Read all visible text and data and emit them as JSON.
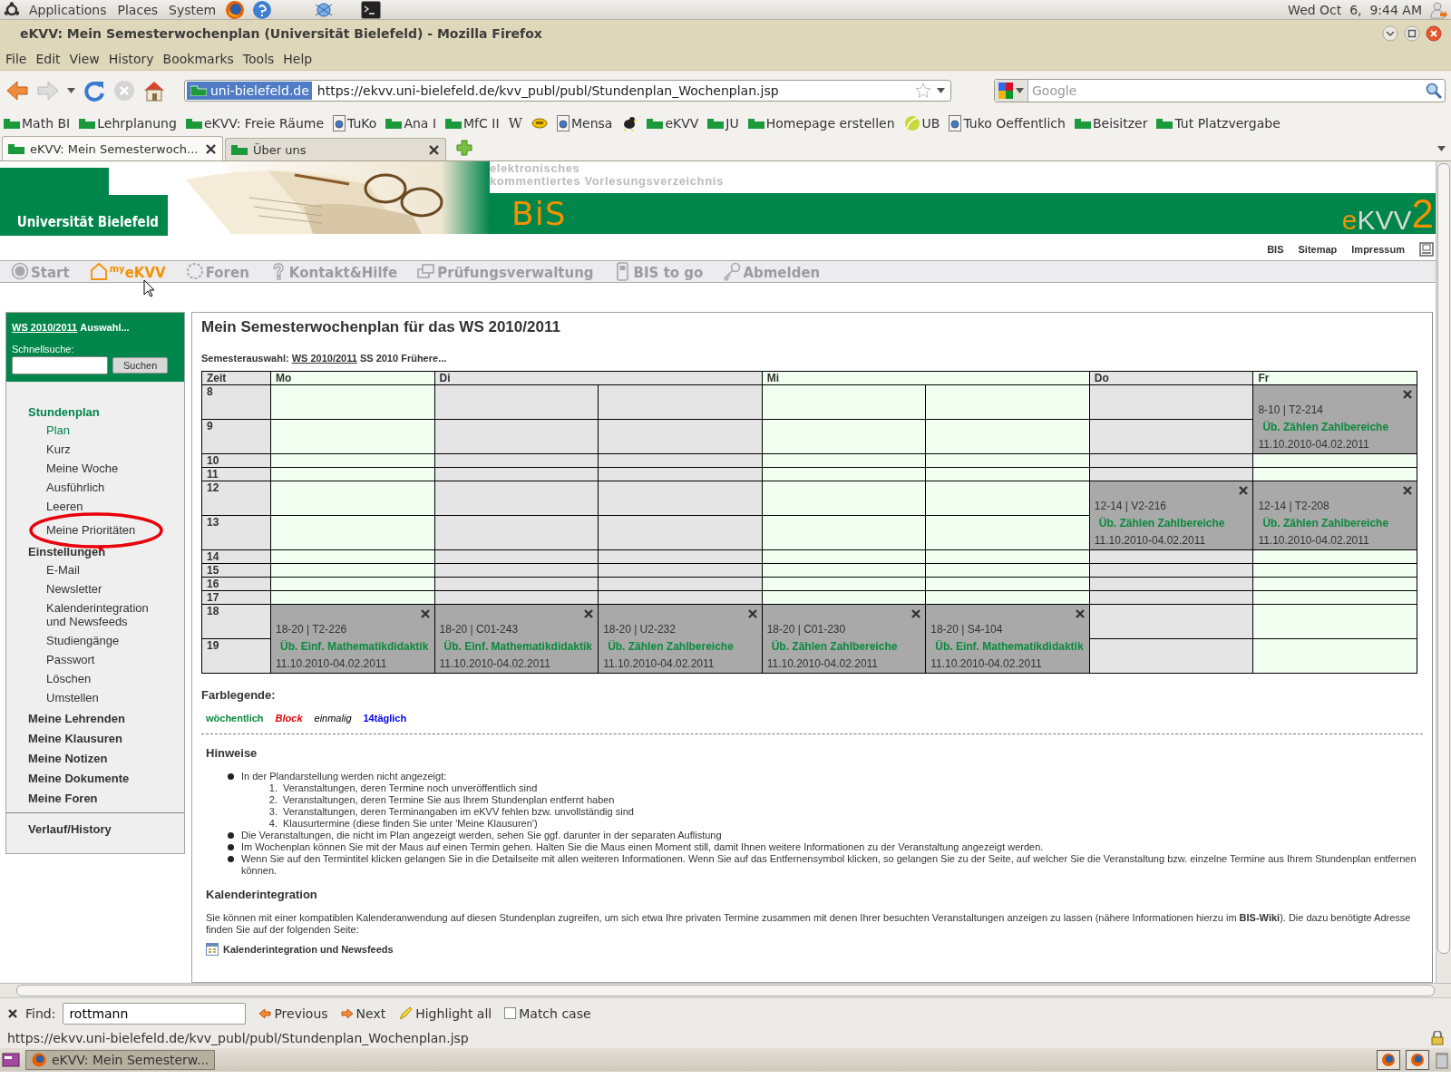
{
  "top_panel": {
    "menus": [
      "Applications",
      "Places",
      "System"
    ],
    "clock": "Wed Oct  6,  9:44 AM"
  },
  "window": {
    "title": "eKVV: Mein Semesterwochenplan (Universität Bielefeld) - Mozilla Firefox"
  },
  "menu_bar": [
    "File",
    "Edit",
    "View",
    "History",
    "Bookmarks",
    "Tools",
    "Help"
  ],
  "address_bar": {
    "site": "uni-bielefeld.de",
    "url": "https://ekvv.uni-bielefeld.de/kvv_publ/publ/Stundenplan_Wochenplan.jsp"
  },
  "search": {
    "placeholder": "Google"
  },
  "bookmarks": [
    {
      "label": "Math BI",
      "kind": "flag"
    },
    {
      "label": "Lehrplanung",
      "kind": "flag"
    },
    {
      "label": "eKVV: Freie Räume",
      "kind": "flag"
    },
    {
      "label": "TuKo",
      "kind": "page"
    },
    {
      "label": "Ana I",
      "kind": "flag"
    },
    {
      "label": "MfC II",
      "kind": "flag"
    },
    {
      "label": "W",
      "kind": "wiki"
    },
    {
      "kind": "coin"
    },
    {
      "label": "Mensa",
      "kind": "page"
    },
    {
      "kind": "bird"
    },
    {
      "label": "eKVV",
      "kind": "flag"
    },
    {
      "label": "JU",
      "kind": "flag"
    },
    {
      "label": "Homepage erstellen",
      "kind": "flag"
    },
    {
      "label": "UB",
      "kind": "leaf"
    },
    {
      "label": "Tuko Oeffentlich",
      "kind": "page"
    },
    {
      "label": "Beisitzer",
      "kind": "flag"
    },
    {
      "label": "Tut Platzvergabe",
      "kind": "flag"
    }
  ],
  "tabs": [
    {
      "label": "eKVV: Mein Semesterwoch...",
      "selected": true
    },
    {
      "label": "Über uns",
      "selected": false
    }
  ],
  "header": {
    "university": "Universität Bielefeld",
    "tagline": [
      "elektronisches",
      "kommentiertes Vorlesungsverzeichnis"
    ],
    "brand": "BiS",
    "logo": [
      {
        "text": "e",
        "color": "#f39200"
      },
      {
        "text": "KVV",
        "color": "#d9d9d9"
      },
      {
        "text": "2",
        "color": "#f39200"
      }
    ]
  },
  "util_links": [
    "BIS",
    "Sitemap",
    "Impressum"
  ],
  "nav": [
    {
      "label": "Start",
      "kind": "start",
      "selected": false
    },
    {
      "label": "$^{my}$eKVV",
      "kind": "home",
      "selected": true
    },
    {
      "label": "Foren",
      "kind": "forum",
      "selected": false
    },
    {
      "label": "Kontakt&Hilfe",
      "kind": "help",
      "selected": false
    },
    {
      "label": "Prüfungsverwaltung",
      "kind": "windows",
      "selected": false
    },
    {
      "label": "BIS to go",
      "kind": "phone",
      "selected": false
    },
    {
      "label": "Abmelden",
      "kind": "key",
      "selected": false
    }
  ],
  "sidebar": {
    "semester": "WS 2010/2011",
    "choose": "Auswahl...",
    "search_label": "Schnellsuche:",
    "search_button": "Suchen",
    "menu": [
      {
        "label": "Stundenplan",
        "selected": true,
        "children": [
          {
            "label": "Plan",
            "selected": true,
            "circled": false
          },
          {
            "label": "Kurz",
            "selected": false,
            "circled": false
          },
          {
            "label": "Meine Woche",
            "selected": false,
            "circled": false
          },
          {
            "label": "Ausführlich",
            "selected": false,
            "circled": false
          },
          {
            "label": "Leeren",
            "selected": false,
            "circled": false
          },
          {
            "label": "Meine Prioritäten",
            "selected": false,
            "circled": true
          }
        ]
      },
      {
        "label": "Einstellungen",
        "selected": false,
        "children": [
          {
            "label": "E-Mail",
            "selected": false,
            "circled": false
          },
          {
            "label": "Newsletter",
            "selected": false,
            "circled": false
          },
          {
            "label": "Kalenderintegration und Newsfeeds",
            "selected": false,
            "circled": false
          },
          {
            "label": "Studiengänge",
            "selected": false,
            "circled": false
          },
          {
            "label": "Passwort",
            "selected": false,
            "circled": false
          },
          {
            "label": "Löschen",
            "selected": false,
            "circled": false
          },
          {
            "label": "Umstellen",
            "selected": false,
            "circled": false
          }
        ]
      },
      {
        "label": "Meine Lehrenden",
        "selected": false
      },
      {
        "label": "Meine Klausuren",
        "selected": false
      },
      {
        "label": "Meine Notizen",
        "selected": false
      },
      {
        "label": "Meine Dokumente",
        "selected": false
      },
      {
        "label": "Meine Foren",
        "selected": false
      }
    ],
    "footer_link": "Verlauf/History"
  },
  "main": {
    "title": "Mein Semesterwochenplan für das WS 2010/2011",
    "semester_select": {
      "label": "Semesterauswahl:",
      "options": [
        {
          "label": "WS 2010/2011",
          "selected": true
        },
        {
          "label": "SS 2010",
          "selected": false
        },
        {
          "label": "Frühere...",
          "selected": false
        }
      ]
    },
    "table": {
      "time_header": "Zeit",
      "days": [
        {
          "label": "Mo",
          "split": false
        },
        {
          "label": "Di",
          "split": true
        },
        {
          "label": "Mi",
          "split": true
        },
        {
          "label": "Do",
          "split": false
        },
        {
          "label": "Fr",
          "split": false
        }
      ],
      "rows": [
        {
          "hour": "8",
          "cells": [
            {
              "kind": "empty"
            },
            {
              "kind": "empty"
            },
            {
              "kind": "empty"
            },
            {
              "kind": "empty"
            },
            {
              "kind": "empty"
            },
            {
              "kind": "empty"
            },
            {
              "kind": "event",
              "time": "8-10 | T2-214",
              "title": "Üb. Zählen Zahlbereiche",
              "dates": "11.10.2010-04.02.2011"
            }
          ]
        },
        {
          "hour": "9",
          "cells": [
            {
              "kind": "empty"
            },
            {
              "kind": "empty"
            },
            {
              "kind": "empty"
            },
            {
              "kind": "empty"
            },
            {
              "kind": "empty"
            },
            {
              "kind": "empty"
            }
          ]
        },
        {
          "hour": "10",
          "cells": [
            {
              "kind": "empty"
            },
            {
              "kind": "empty"
            },
            {
              "kind": "empty"
            },
            {
              "kind": "empty"
            },
            {
              "kind": "empty"
            },
            {
              "kind": "empty"
            },
            {
              "kind": "empty"
            }
          ]
        },
        {
          "hour": "11",
          "cells": [
            {
              "kind": "empty"
            },
            {
              "kind": "empty"
            },
            {
              "kind": "empty"
            },
            {
              "kind": "empty"
            },
            {
              "kind": "empty"
            },
            {
              "kind": "empty"
            },
            {
              "kind": "empty"
            }
          ]
        },
        {
          "hour": "12",
          "cells": [
            {
              "kind": "empty"
            },
            {
              "kind": "empty"
            },
            {
              "kind": "empty"
            },
            {
              "kind": "empty"
            },
            {
              "kind": "empty"
            },
            {
              "kind": "event",
              "time": "12-14 | V2-216",
              "title": "Üb. Zählen Zahlbereiche",
              "dates": "11.10.2010-04.02.2011"
            },
            {
              "kind": "event",
              "time": "12-14 | T2-208",
              "title": "Üb. Zählen Zahlbereiche",
              "dates": "11.10.2010-04.02.2011"
            }
          ]
        },
        {
          "hour": "13",
          "cells": [
            {
              "kind": "empty"
            },
            {
              "kind": "empty"
            },
            {
              "kind": "empty"
            },
            {
              "kind": "empty"
            },
            {
              "kind": "empty"
            }
          ]
        },
        {
          "hour": "14",
          "cells": [
            {
              "kind": "empty"
            },
            {
              "kind": "empty"
            },
            {
              "kind": "empty"
            },
            {
              "kind": "empty"
            },
            {
              "kind": "empty"
            },
            {
              "kind": "empty"
            },
            {
              "kind": "empty"
            }
          ]
        },
        {
          "hour": "15",
          "cells": [
            {
              "kind": "empty"
            },
            {
              "kind": "empty"
            },
            {
              "kind": "empty"
            },
            {
              "kind": "empty"
            },
            {
              "kind": "empty"
            },
            {
              "kind": "empty"
            },
            {
              "kind": "empty"
            }
          ]
        },
        {
          "hour": "16",
          "cells": [
            {
              "kind": "empty"
            },
            {
              "kind": "empty"
            },
            {
              "kind": "empty"
            },
            {
              "kind": "empty"
            },
            {
              "kind": "empty"
            },
            {
              "kind": "empty"
            },
            {
              "kind": "empty"
            }
          ]
        },
        {
          "hour": "17",
          "cells": [
            {
              "kind": "empty"
            },
            {
              "kind": "empty"
            },
            {
              "kind": "empty"
            },
            {
              "kind": "empty"
            },
            {
              "kind": "empty"
            },
            {
              "kind": "empty"
            },
            {
              "kind": "empty"
            }
          ]
        },
        {
          "hour": "18",
          "cells": [
            {
              "kind": "event",
              "time": "18-20 | T2-226",
              "title": "Üb. Einf. Mathematikdidaktik",
              "dates": "11.10.2010-04.02.2011"
            },
            {
              "kind": "event",
              "time": "18-20 | C01-243",
              "title": "Üb. Einf. Mathematikdidaktik",
              "dates": "11.10.2010-04.02.2011"
            },
            {
              "kind": "event",
              "time": "18-20 | U2-232",
              "title": "Üb. Zählen Zahlbereiche",
              "dates": "11.10.2010-04.02.2011"
            },
            {
              "kind": "event",
              "time": "18-20 | C01-230",
              "title": "Üb. Zählen Zahlbereiche",
              "dates": "11.10.2010-04.02.2011"
            },
            {
              "kind": "event",
              "time": "18-20 | S4-104",
              "title": "Üb. Einf. Mathematikdidaktik",
              "dates": "11.10.2010-04.02.2011"
            },
            {
              "kind": "empty"
            },
            {
              "kind": "empty"
            }
          ]
        },
        {
          "hour": "19",
          "cells": [
            {
              "kind": "empty"
            },
            {
              "kind": "empty"
            }
          ]
        }
      ]
    },
    "legend": {
      "title": "Farblegende:",
      "items": [
        {
          "label": "wöchentlich",
          "kind": "weekly",
          "color": "#0a8a3c"
        },
        {
          "label": "Block",
          "kind": "block",
          "color": "#e30000"
        },
        {
          "label": "einmalig",
          "kind": "once",
          "color": "#000000"
        },
        {
          "label": "14täglich",
          "kind": "biweekly",
          "color": "#0000ee"
        }
      ]
    },
    "notes": {
      "title": "Hinweise",
      "items": [
        {
          "text": "In der Plandarstellung werden nicht angezeigt:",
          "children": [
            {
              "marker": "1.",
              "text": "Veranstaltungen, deren Termine noch unveröffentlich sind"
            },
            {
              "marker": "2.",
              "text": "Veranstaltungen, deren Termine Sie aus Ihrem Stundenplan entfernt haben"
            },
            {
              "marker": "3.",
              "text": "Veranstaltungen, deren Terminangaben im eKVV fehlen bzw. unvollständig sind"
            },
            {
              "marker": "4.",
              "text": "Klausurtermine (diese finden Sie unter 'Meine Klausuren')"
            }
          ]
        },
        {
          "text": "Die Veranstaltungen, die nicht im Plan angezeigt werden, sehen Sie ggf. darunter in der separaten Auflistung"
        },
        {
          "text": "Im Wochenplan können Sie mit der Maus auf einen Termin gehen. Halten Sie die Maus einen Moment still, damit Ihnen weitere Informationen zu der Veranstaltung angezeigt werden."
        },
        {
          "text": "Wenn Sie auf den Termintitel klicken gelangen Sie in die Detailseite mit allen weiteren Informationen. Wenn Sie auf das Entfernensymbol klicken, so gelangen Sie zu der Seite, auf welcher Sie die Veranstaltung bzw. einzelne Termine aus Ihrem Stundenplan entfernen können."
        }
      ]
    },
    "calendar": {
      "title": "Kalenderintegration",
      "text": "Sie können mit einer kompatiblen Kalenderanwendung auf diesen Stundenplan zugreifen, um sich etwa Ihre privaten Termine zusammen mit denen Ihrer besuchten Veranstaltungen anzeigen zu lassen (nähere Informationen hierzu im **BIS-Wiki**). Die dazu benötigte Adresse finden Sie auf der folgenden Seite:",
      "link": "Kalenderintegration und Newsfeeds"
    }
  },
  "find_bar": {
    "label": "Find:",
    "value": "rottmann",
    "previous": "Previous",
    "next": "Next",
    "highlight": "Highlight all",
    "match_case": {
      "label": "Match case",
      "checked": false
    }
  },
  "status_bar": {
    "text": "https://ekvv.uni-bielefeld.de/kvv_publ/publ/Stundenplan_Wochenplan.jsp"
  },
  "taskbar": {
    "tasks": [
      {
        "label": "eKVV: Mein Semesterw...",
        "selected": true
      }
    ]
  }
}
